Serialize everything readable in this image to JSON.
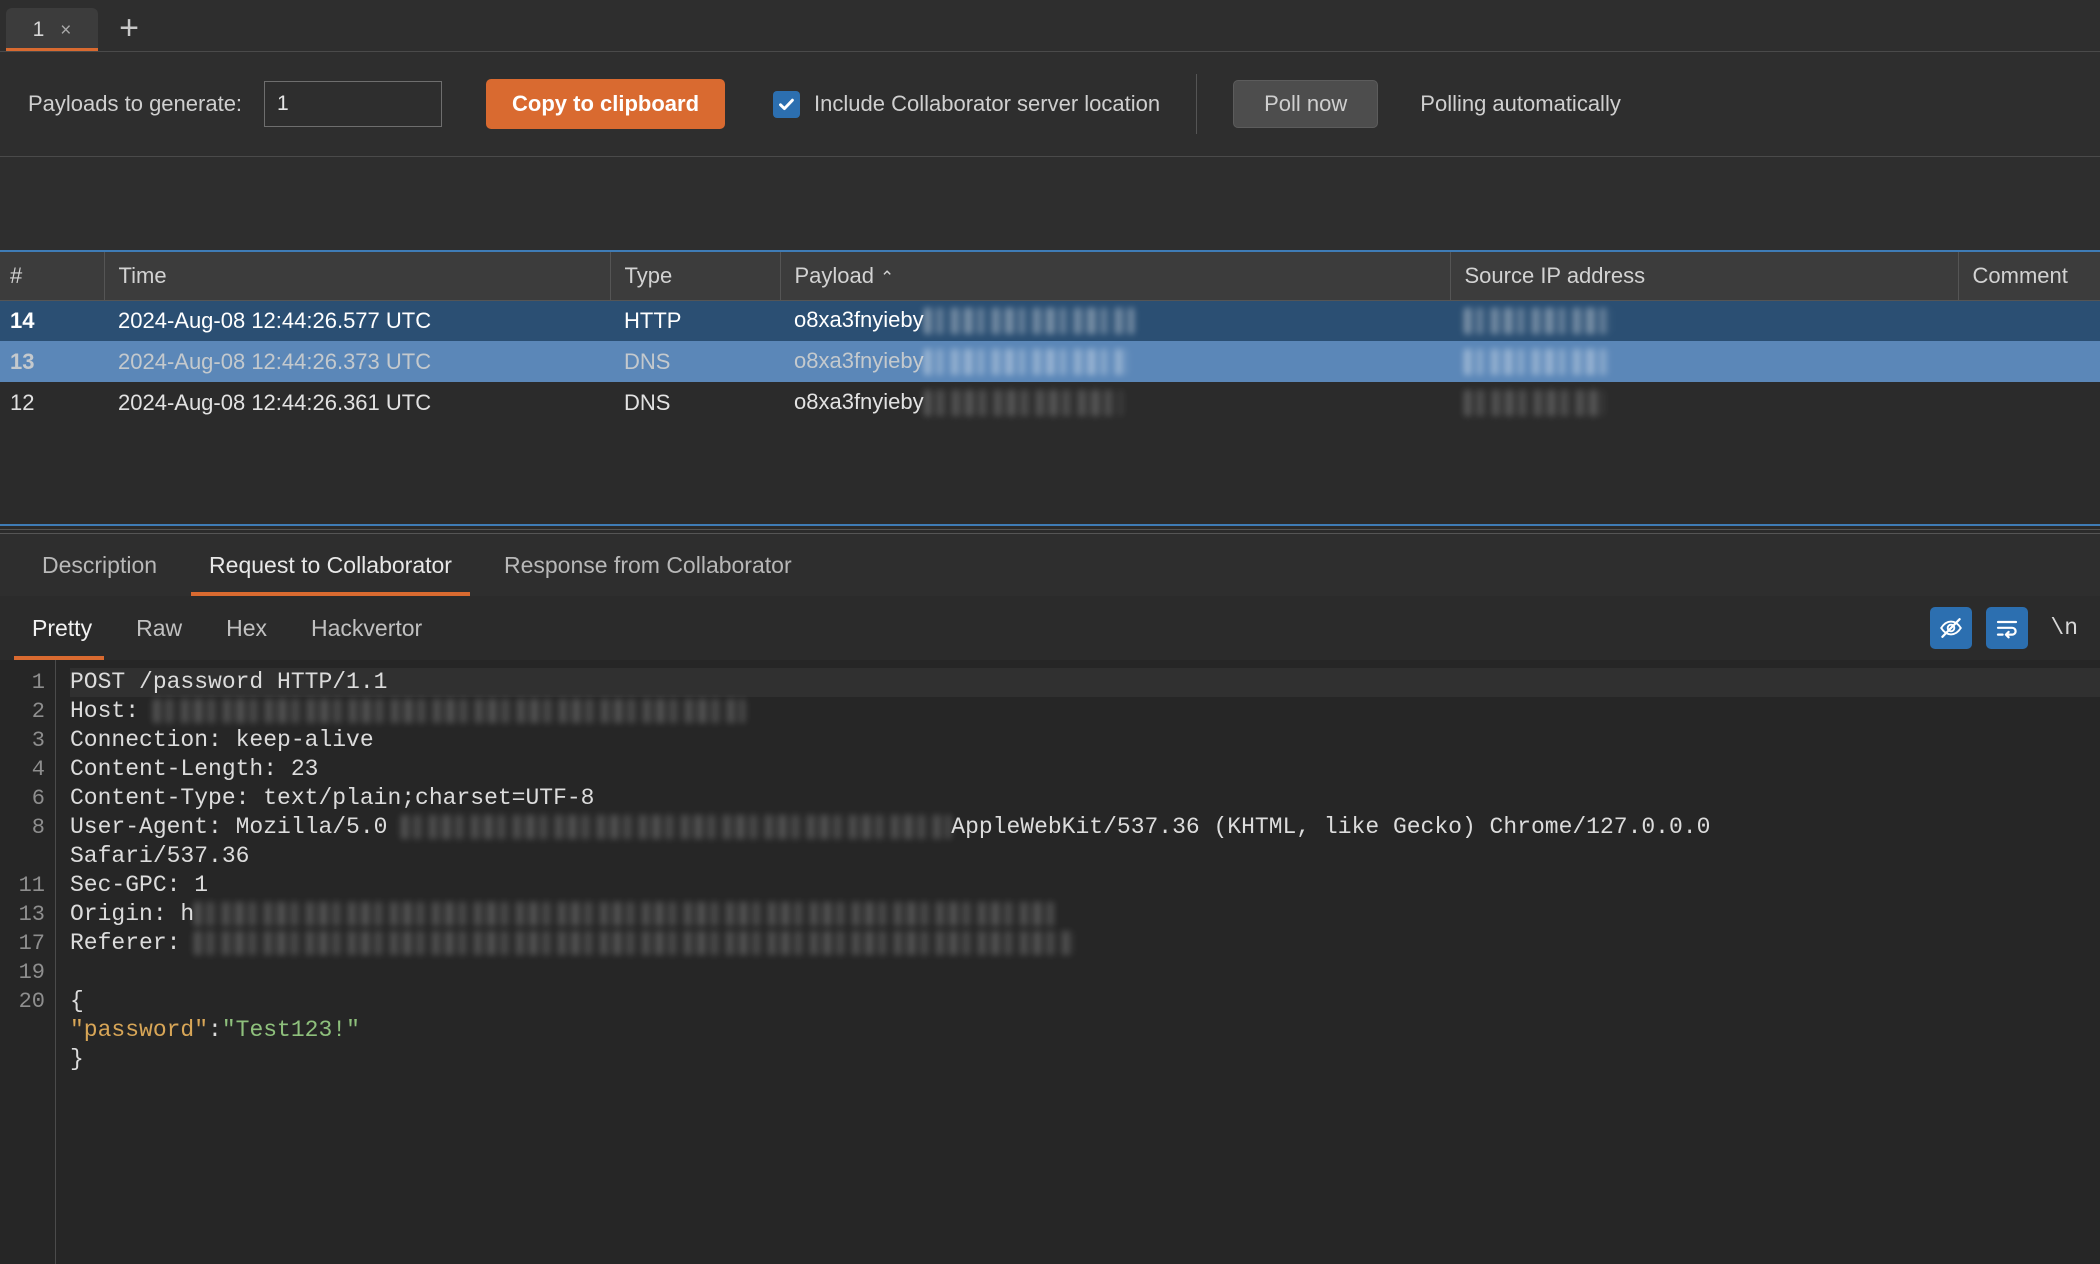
{
  "tabstrip": {
    "tabs": [
      {
        "label": "1",
        "close": "×"
      }
    ],
    "new_tab_label": "+"
  },
  "toolbar": {
    "payloads_label": "Payloads to generate:",
    "payloads_value": "1",
    "payloads_placeholder": "1",
    "copy_button": "Copy to clipboard",
    "include_location_label": "Include Collaborator server location",
    "include_location_checked": true,
    "poll_now_button": "Poll now",
    "polling_status": "Polling automatically",
    "accent_color": "#d96a30",
    "checkbox_color": "#2c6fb0"
  },
  "table": {
    "columns": [
      {
        "key": "num",
        "label": "#"
      },
      {
        "key": "time",
        "label": "Time"
      },
      {
        "key": "type",
        "label": "Type"
      },
      {
        "key": "payload",
        "label": "Payload",
        "sort": "⌃"
      },
      {
        "key": "ip",
        "label": "Source IP address"
      },
      {
        "key": "comment",
        "label": "Comment"
      }
    ],
    "rows": [
      {
        "num": "14",
        "time": "2024-Aug-08 12:44:26.577 UTC",
        "type": "HTTP",
        "payload": "o8xa3fnyieby",
        "payload_redacted": true,
        "ip": "",
        "ip_redacted": true,
        "comment": "",
        "state": "selected-focus"
      },
      {
        "num": "13",
        "time": "2024-Aug-08 12:44:26.373 UTC",
        "type": "DNS",
        "payload": "o8xa3fnyieby",
        "payload_redacted": true,
        "ip": "",
        "ip_redacted": true,
        "comment": "",
        "state": "selected-alt"
      },
      {
        "num": "12",
        "time": "2024-Aug-08 12:44:26.361 UTC",
        "type": "DNS",
        "payload": "o8xa3fnyieby",
        "payload_redacted": true,
        "ip": "",
        "ip_redacted": true,
        "comment": "",
        "state": "normal"
      }
    ]
  },
  "message_tabs": [
    {
      "label": "Description",
      "active": false
    },
    {
      "label": "Request to Collaborator",
      "active": true
    },
    {
      "label": "Response from Collaborator",
      "active": false
    }
  ],
  "view_tabs": [
    {
      "label": "Pretty",
      "active": true
    },
    {
      "label": "Raw",
      "active": false
    },
    {
      "label": "Hex",
      "active": false
    },
    {
      "label": "Hackvertor",
      "active": false
    }
  ],
  "view_actions": {
    "hide_icon": "eye-slash-icon",
    "wrap_icon": "word-wrap-icon",
    "newline_label": "\\n"
  },
  "code": {
    "line_numbers": [
      "1",
      "2",
      "3",
      "4",
      "6",
      "8",
      "",
      "11",
      "13",
      "17",
      "19",
      "20",
      "",
      ""
    ],
    "lines": [
      {
        "text": "POST /password HTTP/1.1",
        "highlight": true
      },
      {
        "label": "Host: ",
        "redacted": true,
        "redact_width": 592
      },
      {
        "text": "Connection: keep-alive"
      },
      {
        "text": "Content-Length: 23"
      },
      {
        "text": "Content-Type: text/plain;charset=UTF-8"
      },
      {
        "label": "User-Agent: Mozilla/5.0 ",
        "redacted": true,
        "redact_width": 550,
        "tail": "AppleWebKit/537.36 (KHTML, like Gecko) Chrome/127.0.0.0"
      },
      {
        "text": "Safari/537.36"
      },
      {
        "text": "Sec-GPC: 1"
      },
      {
        "label": "Origin: h",
        "redacted": true,
        "redact_width": 860
      },
      {
        "label": "Referer: ",
        "redacted": true,
        "redact_width": 880
      },
      {
        "text": ""
      },
      {
        "text": "{"
      },
      {
        "json": true,
        "indent": "  ",
        "key": "\"password\"",
        "colon": ":",
        "value": "\"Test123!\""
      },
      {
        "text": "}"
      }
    ],
    "json_key_color": "#d8a657",
    "json_value_color": "#8ec07c"
  }
}
